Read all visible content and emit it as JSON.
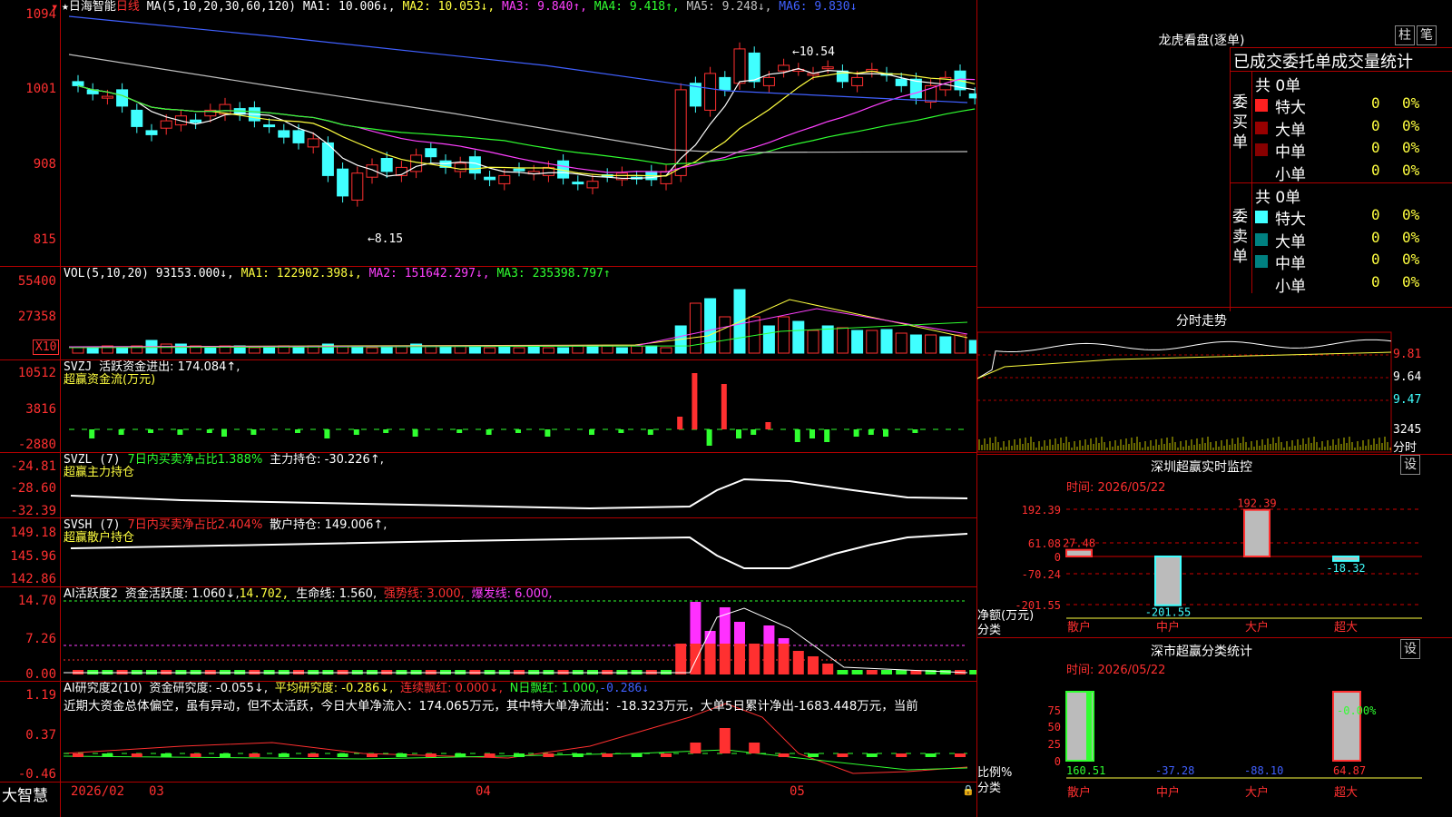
{
  "colors": {
    "up": "#ff3030",
    "down": "#40ffff",
    "ma1": "#ffffff",
    "ma2": "#ffff40",
    "ma3": "#ff40ff",
    "ma4": "#30ff30",
    "ma5": "#c0c0c0",
    "ma6": "#4060ff",
    "border": "#b00000"
  },
  "kline": {
    "star": "★",
    "name": "日海智能",
    "period": "日线",
    "ma_params": "MA(5,10,20,30,60,120)",
    "ma": [
      {
        "label": "MA1: 10.006↓,"
      },
      {
        "label": "MA2: 10.053↓,"
      },
      {
        "label": "MA3: 9.840↑,"
      },
      {
        "label": "MA4: 9.418↑,"
      },
      {
        "label": "MA5: 9.248↓,"
      },
      {
        "label": "MA6: 9.830↓"
      }
    ],
    "yticks": [
      "1094",
      "1001",
      "908",
      "815"
    ],
    "high_label": "10.54",
    "low_label": "8.15"
  },
  "vol": {
    "title": "VOL(5,10,20)",
    "value": "93153.000↓,",
    "ma1": "MA1: 122902.398↓,",
    "ma2": "MA2: 151642.297↓,",
    "ma3": "MA3: 235398.797↑",
    "yticks": [
      "55400",
      "27358"
    ],
    "unit": "X10"
  },
  "svzj": {
    "name": "SVZJ",
    "label": "活跃资金进出: 174.084↑,",
    "sub": "超赢资金流(万元)",
    "yticks": [
      "10512",
      "3816",
      "-2880"
    ]
  },
  "svzl": {
    "name": "SVZL",
    "param": "(7)",
    "ratio": "7日内买卖净占比1.388%",
    "label": "主力持仓: -30.226↑,",
    "sub": "超赢主力持仓",
    "yticks": [
      "-24.81",
      "-28.60",
      "-32.39"
    ]
  },
  "svsh": {
    "name": "SVSH",
    "param": "(7)",
    "ratio": "7日内买卖净占比2.404%",
    "label": "散户持仓: 149.006↑,",
    "sub": "超赢散户持仓",
    "yticks": [
      "149.18",
      "145.96",
      "142.86"
    ]
  },
  "ai2": {
    "name": "AI活跃度2",
    "l1": "资金活跃度: 1.060↓,",
    "l2": "14.702,",
    "l3": "生命线: 1.560,",
    "l4": "强势线: 3.000,",
    "l5": "爆发线: 6.000,",
    "yticks": [
      "14.70",
      "7.26",
      "0.00"
    ]
  },
  "ai_res": {
    "name": "AI研究度2(10)",
    "l1": "资金研究度: -0.055↓,",
    "l2": "平均研究度: -0.286↓,",
    "l3": "连续飘红: 0.000↓,",
    "l4": "N日飘红: 1.000,",
    "l5": "-0.286↓",
    "desc": "近期大资金总体偏空，虽有异动，但不太活跃，今日大单净流入：174.065万元，其中特大单净流出：-18.323万元，大单5日累计净出-1683.448万元，当前",
    "yticks": [
      "1.19",
      "0.37",
      "-0.46"
    ]
  },
  "footer": {
    "brand": "大智慧",
    "d1": "2026/02",
    "d2": "03",
    "d3": "04",
    "d4": "05"
  },
  "right": {
    "title": "龙虎看盘(逐单)",
    "btn1": "柱",
    "btn2": "笔",
    "tabs": "已成交委托单成交量统计",
    "buy": {
      "side": "委买单",
      "total": "共 0单",
      "rows": [
        {
          "label": "特大",
          "count": "0",
          "pct": "0%"
        },
        {
          "label": "大单",
          "count": "0",
          "pct": "0%"
        },
        {
          "label": "中单",
          "count": "0",
          "pct": "0%"
        },
        {
          "label": "小单",
          "count": "0",
          "pct": "0%"
        }
      ]
    },
    "sell": {
      "side": "委卖单",
      "total": "共 0单",
      "rows": [
        {
          "label": "特大",
          "count": "0",
          "pct": "0%"
        },
        {
          "label": "大单",
          "count": "0",
          "pct": "0%"
        },
        {
          "label": "中单",
          "count": "0",
          "pct": "0%"
        },
        {
          "label": "小单",
          "count": "0",
          "pct": "0%"
        }
      ]
    },
    "intraday": {
      "title": "分时走势",
      "p1": "9.81",
      "p2": "9.64",
      "p3": "9.47",
      "vol": "3245",
      "vol_label": "分时"
    },
    "monitor": {
      "title": "深圳超赢实时监控",
      "btn": "设",
      "time": "时间: 2026/05/22",
      "yticks": [
        "192.39",
        "61.08",
        "0",
        "-70.24",
        "-201.55"
      ],
      "values": [
        {
          "cat": "散户",
          "v": "27.48",
          "num": 27.48
        },
        {
          "cat": "中户",
          "v": "-201.55",
          "num": -201.55
        },
        {
          "cat": "大户",
          "v": "192.39",
          "num": 192.39
        },
        {
          "cat": "超大",
          "v": "-18.32",
          "num": -18.32
        }
      ],
      "ylab1": "净额(万元)",
      "ylab2": "分类"
    },
    "stats": {
      "title": "深市超赢分类统计",
      "btn": "设",
      "time": "时间: 2026/05/22",
      "yticks": [
        "75",
        "50",
        "25",
        "0"
      ],
      "values": [
        {
          "cat": "散户",
          "v": "160.51",
          "pct": 100
        },
        {
          "cat": "中户",
          "v": "-37.28",
          "pct": 0
        },
        {
          "cat": "大户",
          "v": "-88.10",
          "pct": 0
        },
        {
          "cat": "超大",
          "v": "64.87",
          "pct": 100,
          "top": "-0.00%"
        }
      ],
      "ylab1": "比例%",
      "ylab2": "分类"
    }
  }
}
